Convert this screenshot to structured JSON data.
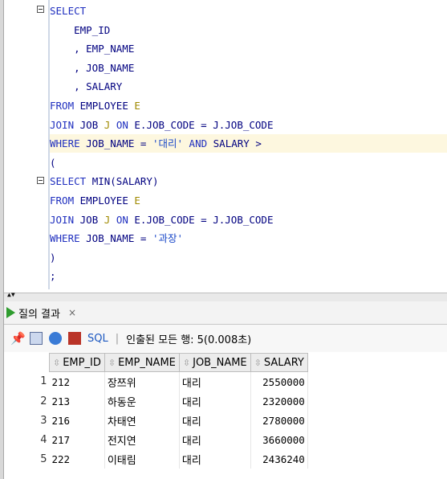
{
  "editor": {
    "lines": [
      {
        "parts": [
          {
            "t": "SELECT",
            "c": "kw"
          }
        ]
      },
      {
        "parts": [
          {
            "t": "    EMP_ID",
            "c": ""
          }
        ]
      },
      {
        "parts": [
          {
            "t": "    , EMP_NAME",
            "c": ""
          }
        ]
      },
      {
        "parts": [
          {
            "t": "    , JOB_NAME",
            "c": ""
          }
        ]
      },
      {
        "parts": [
          {
            "t": "    , SALARY",
            "c": ""
          }
        ]
      },
      {
        "parts": [
          {
            "t": "FROM ",
            "c": "kw"
          },
          {
            "t": "EMPLOYEE ",
            "c": ""
          },
          {
            "t": "E",
            "c": "alias"
          }
        ]
      },
      {
        "parts": [
          {
            "t": "JOIN ",
            "c": "kw"
          },
          {
            "t": "JOB ",
            "c": ""
          },
          {
            "t": "J ",
            "c": "alias"
          },
          {
            "t": "ON ",
            "c": "kw"
          },
          {
            "t": "E.JOB_CODE = J.JOB_CODE",
            "c": ""
          }
        ]
      },
      {
        "parts": [
          {
            "t": "WHERE ",
            "c": "kw"
          },
          {
            "t": "JOB_NAME = ",
            "c": ""
          },
          {
            "t": "'대리'",
            "c": "str"
          },
          {
            "t": " AND ",
            "c": "kw"
          },
          {
            "t": "SALARY >",
            "c": ""
          }
        ]
      },
      {
        "parts": [
          {
            "t": "(",
            "c": ""
          }
        ]
      },
      {
        "parts": [
          {
            "t": "SELECT ",
            "c": "kw"
          },
          {
            "t": "MIN(SALARY)",
            "c": ""
          }
        ]
      },
      {
        "parts": [
          {
            "t": "FROM ",
            "c": "kw"
          },
          {
            "t": "EMPLOYEE ",
            "c": ""
          },
          {
            "t": "E",
            "c": "alias"
          }
        ]
      },
      {
        "parts": [
          {
            "t": "JOIN ",
            "c": "kw"
          },
          {
            "t": "JOB ",
            "c": ""
          },
          {
            "t": "J ",
            "c": "alias"
          },
          {
            "t": "ON ",
            "c": "kw"
          },
          {
            "t": "E.JOB_CODE = J.JOB_CODE",
            "c": ""
          }
        ]
      },
      {
        "parts": [
          {
            "t": "WHERE ",
            "c": "kw"
          },
          {
            "t": "JOB_NAME = ",
            "c": ""
          },
          {
            "t": "'과장'",
            "c": "str"
          }
        ]
      },
      {
        "parts": [
          {
            "t": ")",
            "c": ""
          }
        ]
      },
      {
        "parts": [
          {
            "t": ";",
            "c": ""
          }
        ]
      }
    ],
    "highlight_line": 8
  },
  "results_tab": {
    "label": "질의 결과",
    "close": "×"
  },
  "toolbar": {
    "sql_label": "SQL",
    "separator": "|",
    "status": "인출된 모든 행: 5(0.008초)"
  },
  "table": {
    "columns": [
      "EMP_ID",
      "EMP_NAME",
      "JOB_NAME",
      "SALARY"
    ],
    "rows": [
      {
        "n": "1",
        "emp_id": "212",
        "emp_name": "장쯔위",
        "job_name": "대리",
        "salary": "2550000"
      },
      {
        "n": "2",
        "emp_id": "213",
        "emp_name": "하동운",
        "job_name": "대리",
        "salary": "2320000"
      },
      {
        "n": "3",
        "emp_id": "216",
        "emp_name": "차태연",
        "job_name": "대리",
        "salary": "2780000"
      },
      {
        "n": "4",
        "emp_id": "217",
        "emp_name": "전지연",
        "job_name": "대리",
        "salary": "3660000"
      },
      {
        "n": "5",
        "emp_id": "222",
        "emp_name": "이태림",
        "job_name": "대리",
        "salary": "2436240"
      }
    ]
  },
  "icons": [
    "pin-icon",
    "print-icon",
    "refresh-icon",
    "delete-icon",
    "run-icon",
    "sort-icon",
    "fold-icon"
  ]
}
